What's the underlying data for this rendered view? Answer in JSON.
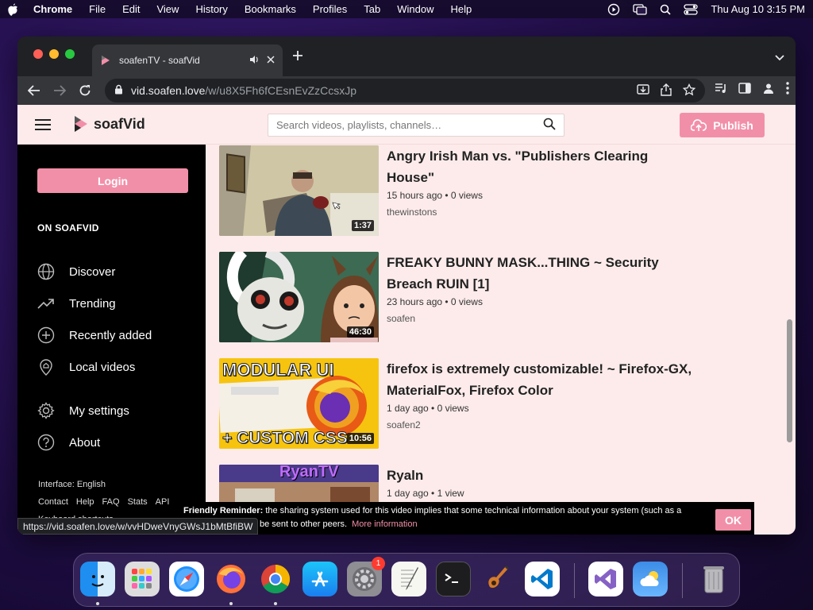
{
  "menubar": {
    "app": "Chrome",
    "items": [
      "File",
      "Edit",
      "View",
      "History",
      "Bookmarks",
      "Profiles",
      "Tab",
      "Window",
      "Help"
    ],
    "datetime": "Thu Aug 10  3:15 PM"
  },
  "browser": {
    "tab_title": "soafenTV - soafVid",
    "url_host": "vid.soafen.love",
    "url_path": "/w/u8X5Fh6fCEsnEvZzCcsxJp",
    "status_url": "https://vid.soafen.love/w/vvHDweVnyGWsJ1bMtBfiBW"
  },
  "site": {
    "logo_text": "soafVid",
    "search_placeholder": "Search videos, playlists, channels…",
    "publish_label": "Publish",
    "login_label": "Login",
    "section_heading": "ON SOAFVID",
    "nav": {
      "discover": "Discover",
      "trending": "Trending",
      "recent": "Recently added",
      "local": "Local videos",
      "settings": "My settings",
      "about": "About"
    },
    "footer": {
      "interface": "Interface: English",
      "contact": "Contact",
      "help": "Help",
      "faq": "FAQ",
      "stats": "Stats",
      "api": "API",
      "shortcuts": "Keyboard shortcuts"
    },
    "videos": [
      {
        "title": "Angry Irish Man vs. \"Publishers Clearing House\"",
        "info": "15 hours ago • 0 views",
        "channel": "thewinstons",
        "duration": "1:37"
      },
      {
        "title": "FREAKY BUNNY MASK...THING ~ Security Breach RUIN [1]",
        "info": "23 hours ago • 0 views",
        "channel": "soafen",
        "duration": "46:30"
      },
      {
        "title": "firefox is extremely customizable! ~ Firefox-GX, MaterialFox, Firefox Color",
        "info": "1 day ago • 0 views",
        "channel": "soafen2",
        "duration": "10:56"
      },
      {
        "title": "Ryaln",
        "info": "1 day ago • 1 view",
        "channel": "",
        "duration": ""
      }
    ],
    "thumb_text": {
      "modular": "MODULAR UI",
      "css": "+ CUSTOM CSS",
      "ryan": "RyanTV"
    },
    "reminder": {
      "label": "Friendly Reminder:",
      "text": "the sharing system used for this video implies that some technical information about your system (such as a",
      "text2": "be sent to other peers.",
      "more": "More information",
      "ok": "OK"
    }
  },
  "dock": {
    "icons": [
      "finder-icon",
      "launchpad-icon",
      "safari-icon",
      "firefox-icon",
      "chrome-icon",
      "app-store-icon",
      "system-settings-icon",
      "textedit-icon",
      "terminal-icon",
      "garageband-icon",
      "vscode-icon",
      "visual-studio-icon",
      "weather-icon",
      "trash-icon"
    ],
    "settings_badge": "1"
  },
  "colors": {
    "accent": "#f28fa8",
    "site_bg": "#fdebeb"
  }
}
